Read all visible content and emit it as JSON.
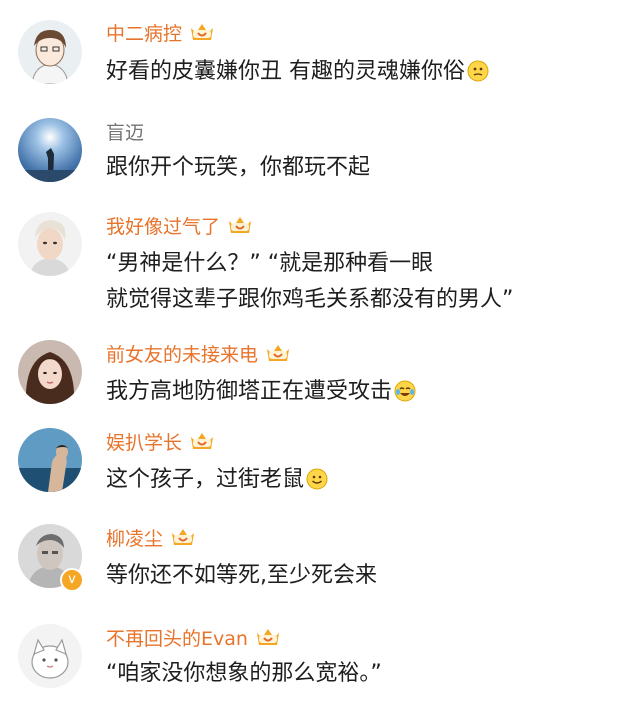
{
  "comments": [
    {
      "username": "中二病控",
      "vip": true,
      "text": "好看的皮囊嫌你丑 有趣的灵魂嫌你俗",
      "emoji": "thinking-face"
    },
    {
      "username": "盲迈",
      "vip": false,
      "text": "跟你开个玩笑，你都玩不起"
    },
    {
      "username": "我好像过气了",
      "vip": true,
      "text": "“男神是什么？”              “就是那种看一眼",
      "text2": "就觉得这辈子跟你鸡毛关系都没有的男人”"
    },
    {
      "username": "前女友的未接来电",
      "vip": true,
      "text": "我方高地防御塔正在遭受攻击",
      "emoji": "crying-laughing-face"
    },
    {
      "username": "娱扒学长",
      "vip": true,
      "text": "这个孩子，过街老鼠",
      "emoji": "smiling-face"
    },
    {
      "username": "柳凌尘",
      "vip": true,
      "verified": true,
      "text": "等你还不如等死,至少死会来"
    },
    {
      "username": "不再回头的Evan",
      "vip": true,
      "text": "“咱家没你想象的那么宽裕。”"
    }
  ],
  "colors": {
    "vip_name": "#e8732b",
    "plain_name": "#737373",
    "text": "#1e1e1e",
    "crown": "#f5a623"
  }
}
